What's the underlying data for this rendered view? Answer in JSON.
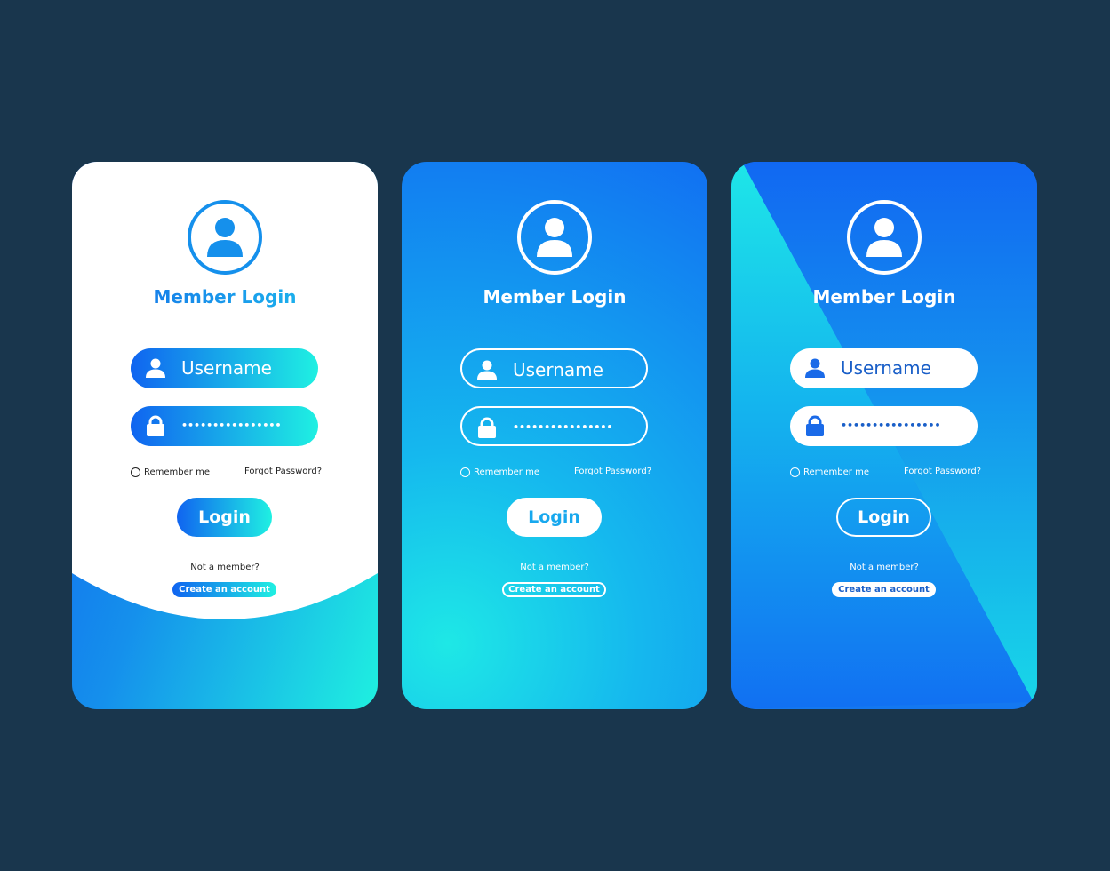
{
  "colors": {
    "background": "#19364d",
    "blue": "#1064f0",
    "cyan": "#1ff0e2",
    "white": "#ffffff"
  },
  "cards": [
    {
      "variant": "white",
      "title": "Member Login",
      "username_placeholder": "Username",
      "password_mask": "••••••••••••••••",
      "remember_label": "Remember me",
      "forgot_label": "Forgot Password?",
      "login_label": "Login",
      "not_member": "Not a member?",
      "create_label": "Create an account",
      "icons": [
        "user-icon",
        "lock-icon"
      ]
    },
    {
      "variant": "gradient-outline",
      "title": "Member Login",
      "username_placeholder": "Username",
      "password_mask": "••••••••••••••••",
      "remember_label": "Remember me",
      "forgot_label": "Forgot Password?",
      "login_label": "Login",
      "not_member": "Not a member?",
      "create_label": "Create an account",
      "icons": [
        "user-icon",
        "lock-icon"
      ]
    },
    {
      "variant": "diagonal",
      "title": "Member Login",
      "username_placeholder": "Username",
      "password_mask": "••••••••••••••••",
      "remember_label": "Remember me",
      "forgot_label": "Forgot Password?",
      "login_label": "Login",
      "not_member": "Not a member?",
      "create_label": "Create an account",
      "icons": [
        "user-icon",
        "lock-icon"
      ]
    }
  ]
}
